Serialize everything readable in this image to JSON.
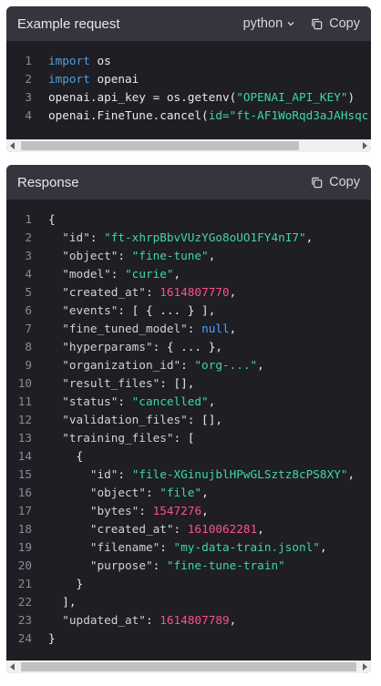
{
  "request_panel": {
    "title": "Example request",
    "language": "python",
    "copy_label": "Copy",
    "line_numbers": [
      "1",
      "2",
      "3",
      "4"
    ],
    "code": [
      [
        {
          "t": "kw",
          "v": "import"
        },
        {
          "t": "pun",
          "v": " os"
        }
      ],
      [
        {
          "t": "kw",
          "v": "import"
        },
        {
          "t": "pun",
          "v": " openai"
        }
      ],
      [
        {
          "t": "pun",
          "v": "openai.api_key = os.getenv("
        },
        {
          "t": "str",
          "v": "\"OPENAI_API_KEY\""
        },
        {
          "t": "pun",
          "v": ")"
        }
      ],
      [
        {
          "t": "pun",
          "v": "openai.FineTune.cancel("
        },
        {
          "t": "str",
          "v": "id="
        },
        {
          "t": "str",
          "v": "\"ft-AF1WoRqd3aJAHsqc"
        }
      ]
    ]
  },
  "response_panel": {
    "title": "Response",
    "copy_label": "Copy",
    "line_numbers": [
      "1",
      "2",
      "3",
      "4",
      "5",
      "6",
      "7",
      "8",
      "9",
      "10",
      "11",
      "12",
      "13",
      "14",
      "15",
      "16",
      "17",
      "18",
      "19",
      "20",
      "21",
      "22",
      "23",
      "24"
    ],
    "code": [
      [
        {
          "t": "pun",
          "v": "{"
        }
      ],
      [
        {
          "t": "pun",
          "v": "  "
        },
        {
          "t": "key",
          "v": "\"id\""
        },
        {
          "t": "pun",
          "v": ": "
        },
        {
          "t": "str",
          "v": "\"ft-xhrpBbvVUzYGo8oUO1FY4nI7\""
        },
        {
          "t": "pun",
          "v": ","
        }
      ],
      [
        {
          "t": "pun",
          "v": "  "
        },
        {
          "t": "key",
          "v": "\"object\""
        },
        {
          "t": "pun",
          "v": ": "
        },
        {
          "t": "str",
          "v": "\"fine-tune\""
        },
        {
          "t": "pun",
          "v": ","
        }
      ],
      [
        {
          "t": "pun",
          "v": "  "
        },
        {
          "t": "key",
          "v": "\"model\""
        },
        {
          "t": "pun",
          "v": ": "
        },
        {
          "t": "str",
          "v": "\"curie\""
        },
        {
          "t": "pun",
          "v": ","
        }
      ],
      [
        {
          "t": "pun",
          "v": "  "
        },
        {
          "t": "key",
          "v": "\"created_at\""
        },
        {
          "t": "pun",
          "v": ": "
        },
        {
          "t": "num",
          "v": "1614807770"
        },
        {
          "t": "pun",
          "v": ","
        }
      ],
      [
        {
          "t": "pun",
          "v": "  "
        },
        {
          "t": "key",
          "v": "\"events\""
        },
        {
          "t": "pun",
          "v": ": [ { ... } ],"
        }
      ],
      [
        {
          "t": "pun",
          "v": "  "
        },
        {
          "t": "key",
          "v": "\"fine_tuned_model\""
        },
        {
          "t": "pun",
          "v": ": "
        },
        {
          "t": "nul",
          "v": "null"
        },
        {
          "t": "pun",
          "v": ","
        }
      ],
      [
        {
          "t": "pun",
          "v": "  "
        },
        {
          "t": "key",
          "v": "\"hyperparams\""
        },
        {
          "t": "pun",
          "v": ": { ... },"
        }
      ],
      [
        {
          "t": "pun",
          "v": "  "
        },
        {
          "t": "key",
          "v": "\"organization_id\""
        },
        {
          "t": "pun",
          "v": ": "
        },
        {
          "t": "str",
          "v": "\"org-...\""
        },
        {
          "t": "pun",
          "v": ","
        }
      ],
      [
        {
          "t": "pun",
          "v": "  "
        },
        {
          "t": "key",
          "v": "\"result_files\""
        },
        {
          "t": "pun",
          "v": ": [],"
        }
      ],
      [
        {
          "t": "pun",
          "v": "  "
        },
        {
          "t": "key",
          "v": "\"status\""
        },
        {
          "t": "pun",
          "v": ": "
        },
        {
          "t": "str",
          "v": "\"cancelled\""
        },
        {
          "t": "pun",
          "v": ","
        }
      ],
      [
        {
          "t": "pun",
          "v": "  "
        },
        {
          "t": "key",
          "v": "\"validation_files\""
        },
        {
          "t": "pun",
          "v": ": [],"
        }
      ],
      [
        {
          "t": "pun",
          "v": "  "
        },
        {
          "t": "key",
          "v": "\"training_files\""
        },
        {
          "t": "pun",
          "v": ": ["
        }
      ],
      [
        {
          "t": "pun",
          "v": "    {"
        }
      ],
      [
        {
          "t": "pun",
          "v": "      "
        },
        {
          "t": "key",
          "v": "\"id\""
        },
        {
          "t": "pun",
          "v": ": "
        },
        {
          "t": "str",
          "v": "\"file-XGinujblHPwGLSztz8cPS8XY\""
        },
        {
          "t": "pun",
          "v": ","
        }
      ],
      [
        {
          "t": "pun",
          "v": "      "
        },
        {
          "t": "key",
          "v": "\"object\""
        },
        {
          "t": "pun",
          "v": ": "
        },
        {
          "t": "str",
          "v": "\"file\""
        },
        {
          "t": "pun",
          "v": ","
        }
      ],
      [
        {
          "t": "pun",
          "v": "      "
        },
        {
          "t": "key",
          "v": "\"bytes\""
        },
        {
          "t": "pun",
          "v": ": "
        },
        {
          "t": "num",
          "v": "1547276"
        },
        {
          "t": "pun",
          "v": ","
        }
      ],
      [
        {
          "t": "pun",
          "v": "      "
        },
        {
          "t": "key",
          "v": "\"created_at\""
        },
        {
          "t": "pun",
          "v": ": "
        },
        {
          "t": "num",
          "v": "1610062281"
        },
        {
          "t": "pun",
          "v": ","
        }
      ],
      [
        {
          "t": "pun",
          "v": "      "
        },
        {
          "t": "key",
          "v": "\"filename\""
        },
        {
          "t": "pun",
          "v": ": "
        },
        {
          "t": "str",
          "v": "\"my-data-train.jsonl\""
        },
        {
          "t": "pun",
          "v": ","
        }
      ],
      [
        {
          "t": "pun",
          "v": "      "
        },
        {
          "t": "key",
          "v": "\"purpose\""
        },
        {
          "t": "pun",
          "v": ": "
        },
        {
          "t": "str",
          "v": "\"fine-tune-train\""
        }
      ],
      [
        {
          "t": "pun",
          "v": "    }"
        }
      ],
      [
        {
          "t": "pun",
          "v": "  ],"
        }
      ],
      [
        {
          "t": "pun",
          "v": "  "
        },
        {
          "t": "key",
          "v": "\"updated_at\""
        },
        {
          "t": "pun",
          "v": ": "
        },
        {
          "t": "num",
          "v": "1614807789"
        },
        {
          "t": "pun",
          "v": ","
        }
      ],
      [
        {
          "t": "pun",
          "v": "}"
        }
      ]
    ]
  },
  "colors": {
    "panel_bg": "#1e1e24",
    "header_bg": "#35353d",
    "keyword": "#569cd6",
    "string": "#3fd6a8",
    "number": "#ff4f8a",
    "null": "#4aa3ff"
  },
  "icons": {
    "copy": "copy-icon",
    "language_dropdown": "chevron-down-icon"
  }
}
